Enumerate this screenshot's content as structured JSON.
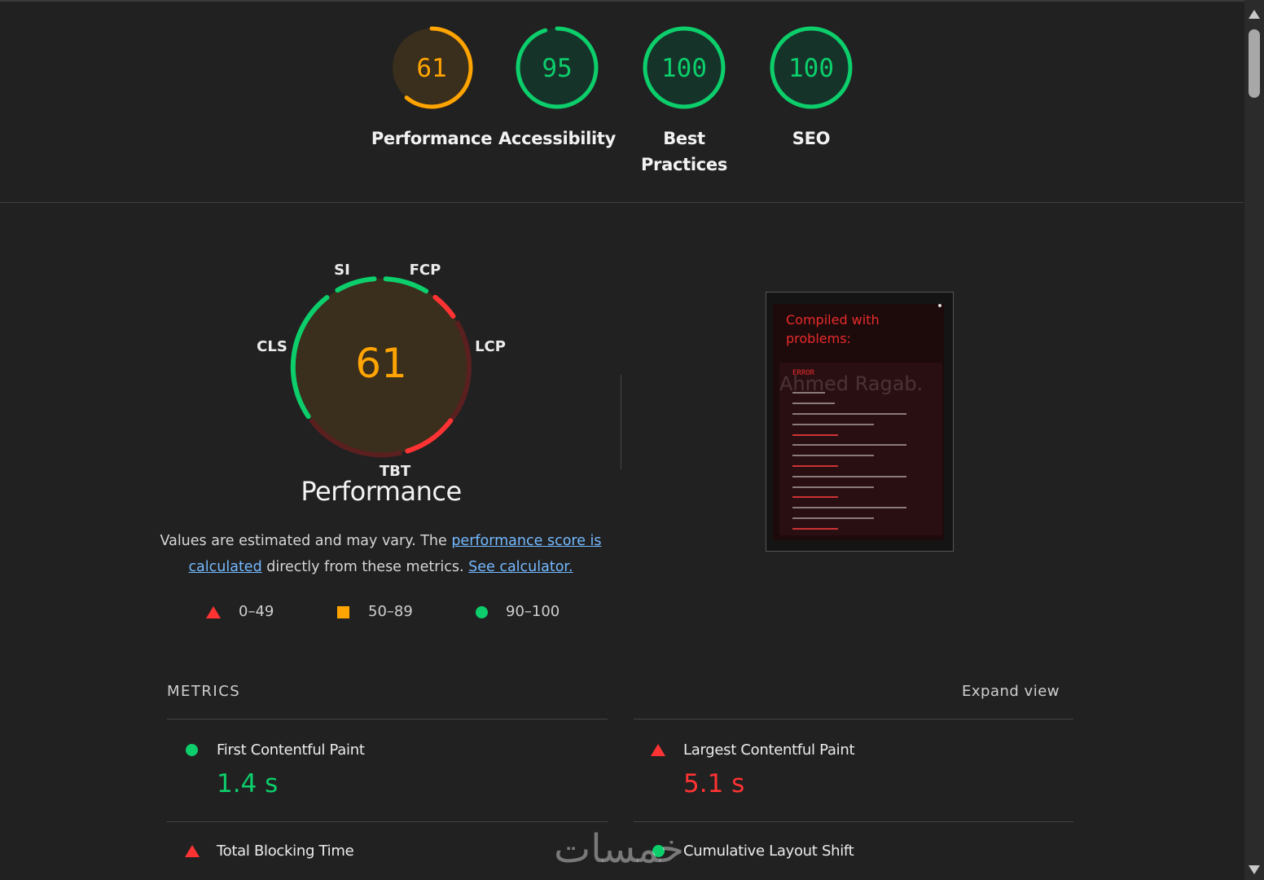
{
  "categories": [
    {
      "score": "61",
      "label_lines": [
        "Performance"
      ],
      "fraction": 0.61,
      "color": "#ffa400",
      "bg": "#3a2e1c"
    },
    {
      "score": "95",
      "label_lines": [
        "Accessibility"
      ],
      "fraction": 0.95,
      "color": "#0cce6b",
      "bg": "#16332a"
    },
    {
      "score": "100",
      "label_lines": [
        "Best",
        "Practices"
      ],
      "fraction": 1.0,
      "color": "#0cce6b",
      "bg": "#16332a"
    },
    {
      "score": "100",
      "label_lines": [
        "SEO"
      ],
      "fraction": 1.0,
      "color": "#0cce6b",
      "bg": "#16332a"
    }
  ],
  "performance": {
    "score": "61",
    "score_color": "#ffa400",
    "title": "Performance",
    "segments": [
      {
        "name": "SI",
        "good": true
      },
      {
        "name": "FCP",
        "good": true
      },
      {
        "name": "LCP",
        "good": false
      },
      {
        "name": "TBT",
        "good": false
      },
      {
        "name": "CLS",
        "good": true
      }
    ],
    "description_prefix": "Values are estimated and may vary. The ",
    "link_score": "performance score is calculated",
    "description_mid": " directly from these metrics. ",
    "link_calculator": "See calculator."
  },
  "legend": [
    {
      "icon": "triangle-icon",
      "text": "0–49"
    },
    {
      "icon": "square-icon",
      "text": "50–89"
    },
    {
      "icon": "circle-icon",
      "text": "90–100"
    }
  ],
  "preview": {
    "title": "Compiled with problems:",
    "error_label": "ERROR",
    "watermark_text": "Ahmed Ragab."
  },
  "metrics": {
    "heading": "METRICS",
    "expand_label": "Expand view",
    "items": [
      {
        "label": "First Contentful Paint",
        "value": "1.4 s",
        "status": "good"
      },
      {
        "label": "Largest Contentful Paint",
        "value": "5.1 s",
        "status": "poor"
      },
      {
        "label": "Total Blocking Time",
        "value": "",
        "status": "poor"
      },
      {
        "label": "Cumulative Layout Shift",
        "value": "",
        "status": "good"
      }
    ]
  },
  "watermark": "خمسات",
  "colors": {
    "good": "#0cce6b",
    "average": "#ffa400",
    "poor": "#ff3333"
  }
}
